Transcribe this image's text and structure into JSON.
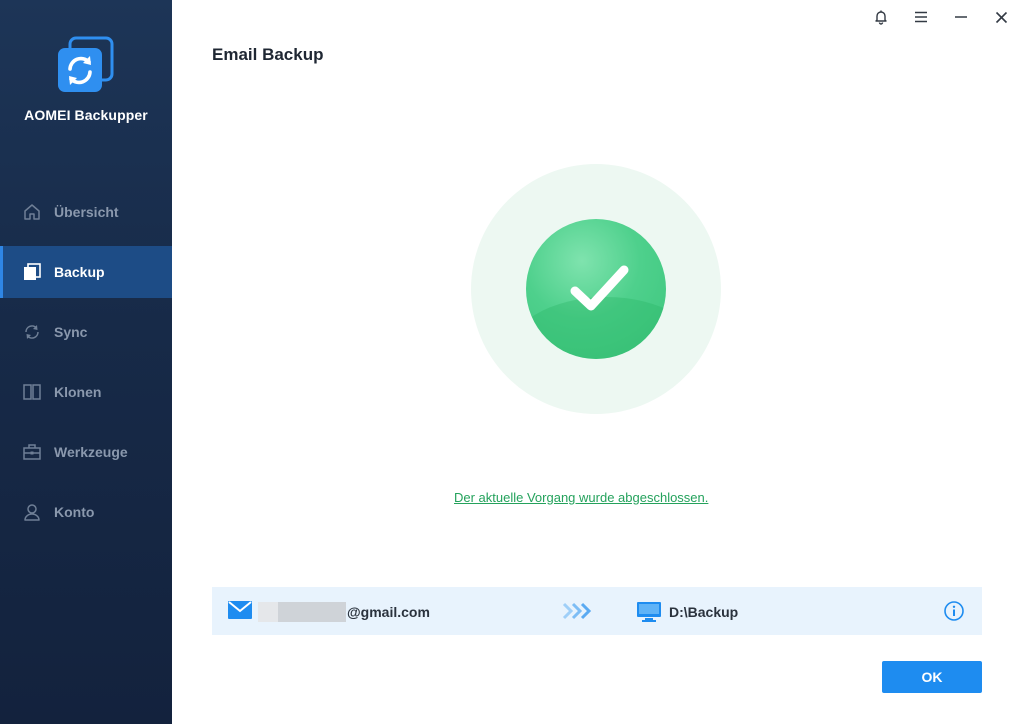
{
  "app": {
    "name": "AOMEI Backupper",
    "logo_icon": "aomei-sync-logo-icon"
  },
  "sidebar": {
    "items": [
      {
        "label": "Übersicht",
        "icon": "home-icon",
        "active": false
      },
      {
        "label": "Backup",
        "icon": "backup-copy-icon",
        "active": true
      },
      {
        "label": "Sync",
        "icon": "sync-icon",
        "active": false
      },
      {
        "label": "Klonen",
        "icon": "clone-icon",
        "active": false
      },
      {
        "label": "Werkzeuge",
        "icon": "toolbox-icon",
        "active": false
      },
      {
        "label": "Konto",
        "icon": "user-icon",
        "active": false
      }
    ]
  },
  "titlebar": {
    "controls": [
      "bell-icon",
      "menu-icon",
      "minimize-icon",
      "close-icon"
    ]
  },
  "page": {
    "title": "Email Backup",
    "status_icon": "success-check-icon",
    "status_message": "Der aktuelle Vorgang wurde abgeschlossen."
  },
  "backup_path": {
    "source_icon": "mail-icon",
    "source": "@gmail.com",
    "arrow_icon": "triple-chevron-right-icon",
    "destination_icon": "computer-icon",
    "destination": "D:\\Backup",
    "info_icon": "info-icon"
  },
  "footer": {
    "ok_label": "OK"
  },
  "colors": {
    "sidebar_bg": "#172a48",
    "sidebar_active": "#1d4c86",
    "accent_blue": "#1e8cf0",
    "success_green": "#3cc57c",
    "link_green": "#24a25c",
    "path_row_bg": "#e8f3fd"
  }
}
